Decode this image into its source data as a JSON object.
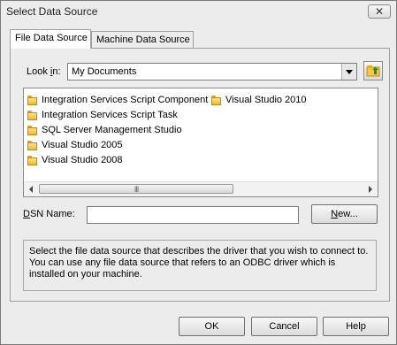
{
  "window": {
    "title": "Select Data Source",
    "close_glyph": "✕"
  },
  "tabs": [
    {
      "label": "File Data Source",
      "active": true
    },
    {
      "label": "Machine Data Source",
      "active": false
    }
  ],
  "look_in": {
    "label_pre": "Look ",
    "label_u": "i",
    "label_post": "n:",
    "value": "My Documents"
  },
  "folders": [
    "Integration Services Script Component",
    "Integration Services Script Task",
    "SQL Server Management Studio",
    "Visual Studio 2005",
    "Visual Studio 2008",
    "Visual Studio 2010"
  ],
  "scrollbar": {
    "thumb_grip": "III"
  },
  "dsn": {
    "label_u": "D",
    "label_post": "SN Name:",
    "value": ""
  },
  "buttons": {
    "new_u": "N",
    "new_post": "ew...",
    "ok": "OK",
    "cancel": "Cancel",
    "help": "Help"
  },
  "description": "Select the file data source that describes the driver that you wish to connect to. You can use any file data source that refers to an ODBC driver which is installed on your machine."
}
